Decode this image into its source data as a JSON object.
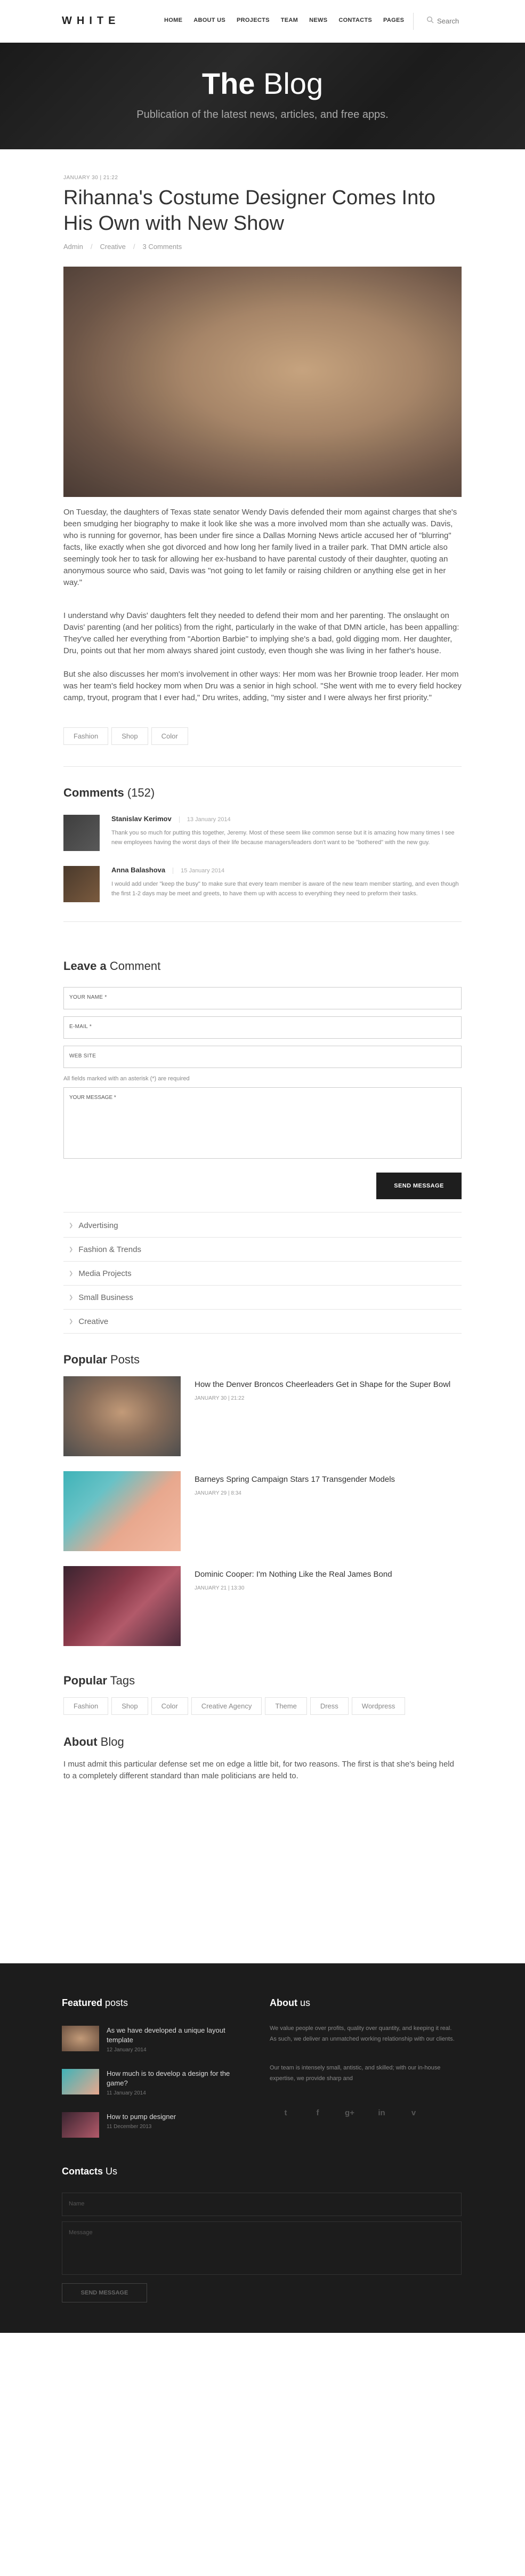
{
  "header": {
    "logo": "WHITE",
    "nav": [
      "HOME",
      "ABOUT US",
      "PROJECTS",
      "TEAM",
      "NEWS",
      "CONTACTS",
      "PAGES"
    ],
    "search_placeholder": "Search"
  },
  "hero": {
    "title_bold": "The",
    "title_rest": " Blog",
    "subtitle": "Publication of the latest news, articles, and free apps."
  },
  "post": {
    "date": "JANUARY 30 | 21:22",
    "title": "Rihanna's Costume Designer Comes Into His Own with New Show",
    "meta": [
      "Admin",
      "Creative",
      "3 Comments"
    ],
    "paragraphs": [
      "On Tuesday, the daughters of Texas state senator Wendy Davis defended their mom against charges that she's been smudging her biography to make it look like she was a more involved mom than she actually was. Davis, who is running for governor, has been under fire since a Dallas Morning News article accused her of \"blurring\" facts, like exactly when she got divorced and how long her family lived in a trailer park. That DMN article also seemingly took her to task for allowing her ex-husband to have parental custody of their daughter, quoting an anonymous source who said, Davis was \"not going to let family or raising children or anything else get in her way.\"",
      "I understand why Davis' daughters felt they needed to defend their mom and her parenting. The onslaught on Davis' parenting (and her politics) from the right, particularly in the wake of that DMN article, has been appalling: They've called her everything from \"Abortion Barbie\" to implying she's a bad, gold digging mom. Her daughter, Dru, points out that her mom always shared joint custody, even though she was living in her father's house.",
      "But she also discusses her mom's involvement in other ways: Her mom was her Brownie troop leader. Her mom was her team's field hockey mom when Dru was a senior in high school. \"She went with me to every field hockey camp, tryout, program that I ever had,\" Dru writes, adding, \"my sister and I were always her first priority.\""
    ],
    "tags": [
      "Fashion",
      "Shop",
      "Color"
    ]
  },
  "comments": {
    "title_bold": "Comments",
    "count": "(152)",
    "items": [
      {
        "author": "Stanislav Kerimov",
        "date": "13 January 2014",
        "text": "Thank you so much for putting this together, Jeremy. Most of these seem like common sense but it is amazing how many times I see new employees having the worst days of their life because managers/leaders don't want to be \"bothered\" with the new guy."
      },
      {
        "author": "Anna Balashova",
        "date": "15 January 2014",
        "text": "I would add under \"keep the busy\" to make sure that every team member is aware of the new team member starting, and even though the first 1-2 days may be meet and greets, to have them up with access to everything they need to preform their tasks."
      }
    ]
  },
  "leave_comment": {
    "title_bold": "Leave a",
    "title_rest": " Comment",
    "name": "YOUR NAME *",
    "email": "E-MAIL *",
    "website": "WEB SITE",
    "note": "All fields marked with an asterisk (*) are required",
    "message": "YOUR MESSAGE *",
    "send": "SEND MESSAGE"
  },
  "categories": [
    "Advertising",
    "Fashion & Trends",
    "Media Projects",
    "Small Business",
    "Creative"
  ],
  "popular_posts": {
    "title_bold": "Popular",
    "title_rest": " Posts",
    "items": [
      {
        "title": "How the Denver Broncos Cheerleaders Get in Shape for the Super Bowl",
        "date": "JANUARY 30 | 21:22"
      },
      {
        "title": "Barneys Spring Campaign Stars 17 Transgender Models",
        "date": "JANUARY 29 | 8:34"
      },
      {
        "title": "Dominic Cooper: I'm Nothing Like the Real James Bond",
        "date": "JANUARY 21 | 13:30"
      }
    ]
  },
  "popular_tags": {
    "title_bold": "Popular",
    "title_rest": " Tags",
    "items": [
      "Fashion",
      "Shop",
      "Color",
      "Creative Agency",
      "Theme",
      "Dress",
      "Wordpress"
    ]
  },
  "about_blog": {
    "title_bold": "About",
    "title_rest": " Blog",
    "text": "I must admit this particular defense set me on edge a little bit, for two reasons. The first is that she's being held to a completely different standard than male politicians are held to."
  },
  "footer": {
    "featured_bold": "Featured",
    "featured_rest": " posts",
    "featured": [
      {
        "title": "As we have developed a unique layout template",
        "date": "12 January 2014"
      },
      {
        "title": "How much is to develop a design for the game?",
        "date": "11 January 2014"
      },
      {
        "title": "How to pump designer",
        "date": "11 December 2013"
      }
    ],
    "about_bold": "About",
    "about_rest": " us",
    "about_p1": "We value people over profits, quality over quantity, and keeping it real. As such, we deliver an unmatched working relationship with our clients.",
    "about_p2": "Our team is intensely small, antistic, and skilled; with our in-house expertise, we provide sharp and",
    "social": [
      "t",
      "f",
      "g+",
      "in",
      "v"
    ],
    "contacts_bold": "Contacts",
    "contacts_rest": " Us",
    "name_ph": "Name",
    "message_ph": "Message",
    "send": "SEND MESSAGE"
  }
}
